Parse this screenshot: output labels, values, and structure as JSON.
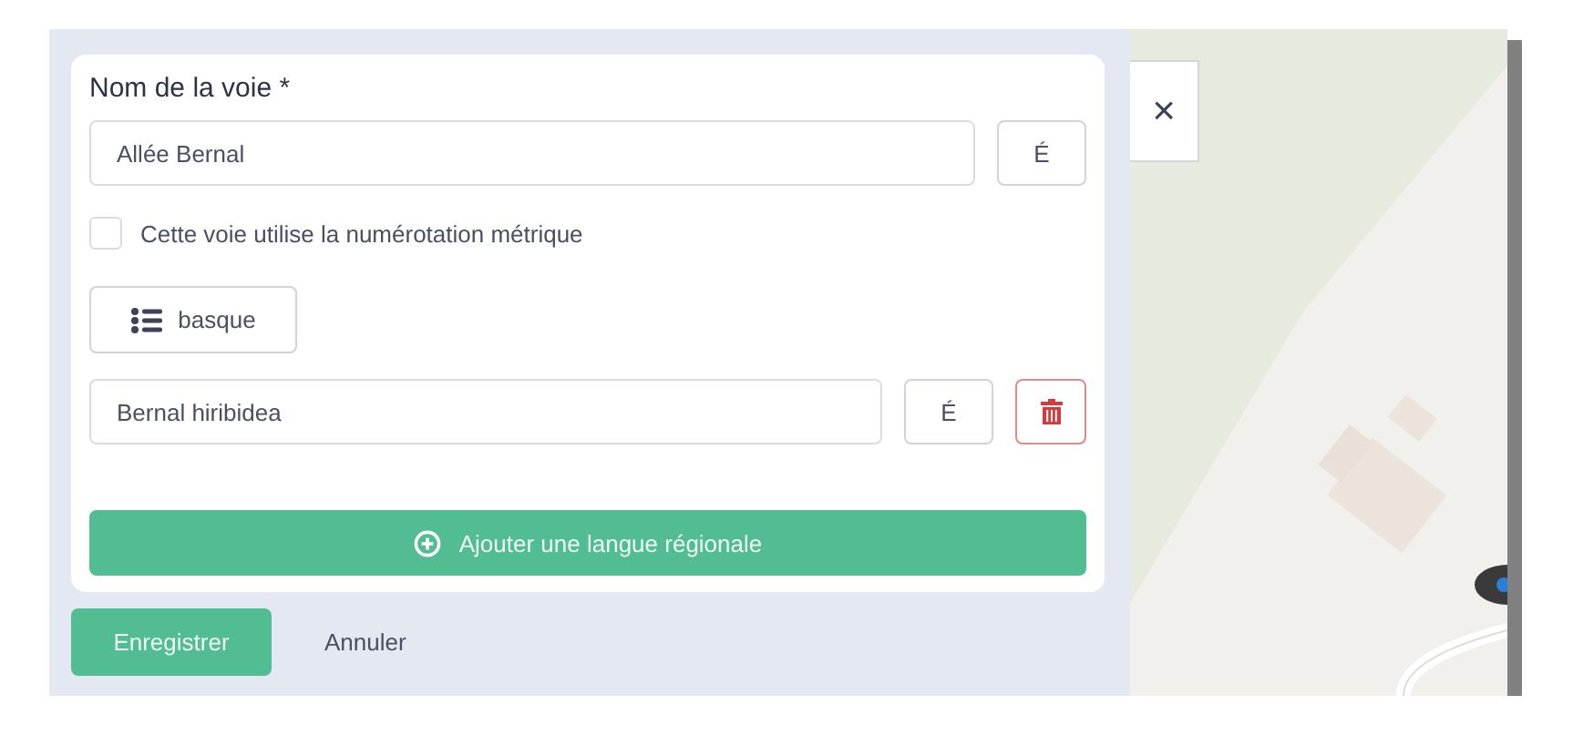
{
  "street_name": {
    "label": "Nom de la voie *",
    "value": "Allée Bernal",
    "accent_button": "É"
  },
  "metric_numbering": {
    "label": "Cette voie utilise la numérotation métrique",
    "checked": false
  },
  "language_selector": {
    "label": "basque"
  },
  "regional_names": [
    {
      "value": "Bernal hiribidea",
      "accent_button": "É"
    }
  ],
  "add_language_button": "Ajouter une langue régionale",
  "actions": {
    "save": "Enregistrer",
    "cancel": "Annuler"
  },
  "close_button": "×"
}
